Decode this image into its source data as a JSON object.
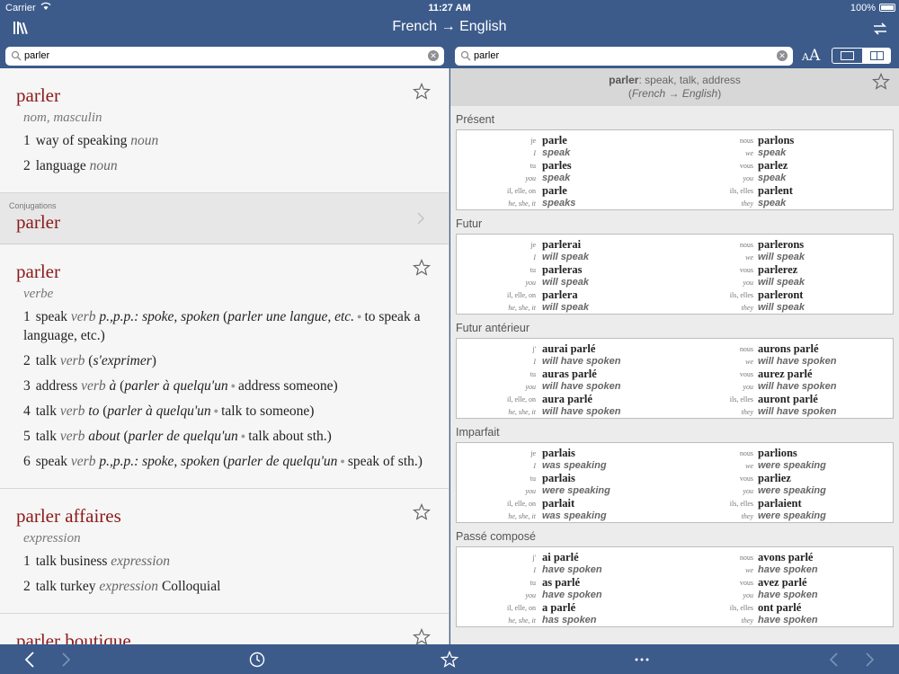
{
  "status": {
    "carrier": "Carrier",
    "time": "11:27 AM",
    "battery": "100%"
  },
  "nav": {
    "title": "French → English"
  },
  "search": {
    "left_value": "parler",
    "right_value": "parler"
  },
  "left": {
    "entry1": {
      "headword": "parler",
      "pos": "nom, masculin",
      "senses": [
        {
          "num": "1",
          "text": "way of speaking",
          "pos": "noun"
        },
        {
          "num": "2",
          "text": "language",
          "pos": "noun"
        }
      ]
    },
    "conjugations": {
      "label": "Conjugations",
      "headword": "parler"
    },
    "entry2": {
      "headword": "parler",
      "pos": "verbe",
      "senses": [
        {
          "num": "1",
          "text": "speak",
          "pos": "verb",
          "note": "p.,p.p.: spoke, spoken",
          "ex_fr": "parler une langue, etc.",
          "ex_en": "to speak a language, etc."
        },
        {
          "num": "2",
          "text": "talk",
          "pos": "verb",
          "ex_fr": "s'exprimer"
        },
        {
          "num": "3",
          "text": "address",
          "pos": "verb",
          "prep": "à",
          "ex_fr": "parler à quelqu'un",
          "ex_en": "address someone"
        },
        {
          "num": "4",
          "text": "talk",
          "pos": "verb",
          "prep": "to",
          "ex_fr": "parler à quelqu'un",
          "ex_en": "talk to someone"
        },
        {
          "num": "5",
          "text": "talk",
          "pos": "verb",
          "prep": "about",
          "ex_fr": "parler de quelqu'un",
          "ex_en": "talk about sth."
        },
        {
          "num": "6",
          "text": "speak",
          "pos": "verb",
          "note": "p.,p.p.: spoke, spoken",
          "ex_fr": "parler de quelqu'un",
          "ex_en": "speak of sth."
        }
      ]
    },
    "entry3": {
      "headword": "parler affaires",
      "pos": "expression",
      "senses": [
        {
          "num": "1",
          "text": "talk business",
          "pos": "expression"
        },
        {
          "num": "2",
          "text": "talk turkey",
          "pos": "expression",
          "extra": "Colloquial"
        }
      ]
    },
    "entry4": {
      "headword": "parler boutique"
    }
  },
  "right": {
    "summary_word": "parler",
    "summary_def": ": speak, talk, address",
    "summary_lang": "French → English",
    "tenses": [
      {
        "name": "Présent",
        "l": [
          [
            "je",
            "parle",
            "I",
            "speak"
          ],
          [
            "tu",
            "parles",
            "you",
            "speak"
          ],
          [
            "il, elle, on",
            "parle",
            "he, she, it",
            "speaks"
          ]
        ],
        "r": [
          [
            "nous",
            "parlons",
            "we",
            "speak"
          ],
          [
            "vous",
            "parlez",
            "you",
            "speak"
          ],
          [
            "ils, elles",
            "parlent",
            "they",
            "speak"
          ]
        ]
      },
      {
        "name": "Futur",
        "l": [
          [
            "je",
            "parlerai",
            "I",
            "will speak"
          ],
          [
            "tu",
            "parleras",
            "you",
            "will speak"
          ],
          [
            "il, elle, on",
            "parlera",
            "he, she, it",
            "will speak"
          ]
        ],
        "r": [
          [
            "nous",
            "parlerons",
            "we",
            "will speak"
          ],
          [
            "vous",
            "parlerez",
            "you",
            "will speak"
          ],
          [
            "ils, elles",
            "parleront",
            "they",
            "will speak"
          ]
        ]
      },
      {
        "name": "Futur antérieur",
        "l": [
          [
            "j'",
            "aurai parlé",
            "I",
            "will have spoken"
          ],
          [
            "tu",
            "auras parlé",
            "you",
            "will have spoken"
          ],
          [
            "il, elle, on",
            "aura parlé",
            "he, she, it",
            "will have spoken"
          ]
        ],
        "r": [
          [
            "nous",
            "aurons parlé",
            "we",
            "will have spoken"
          ],
          [
            "vous",
            "aurez parlé",
            "you",
            "will have spoken"
          ],
          [
            "ils, elles",
            "auront parlé",
            "they",
            "will have spoken"
          ]
        ]
      },
      {
        "name": "Imparfait",
        "l": [
          [
            "je",
            "parlais",
            "I",
            "was speaking"
          ],
          [
            "tu",
            "parlais",
            "you",
            "were speaking"
          ],
          [
            "il, elle, on",
            "parlait",
            "he, she, it",
            "was speaking"
          ]
        ],
        "r": [
          [
            "nous",
            "parlions",
            "we",
            "were speaking"
          ],
          [
            "vous",
            "parliez",
            "you",
            "were speaking"
          ],
          [
            "ils, elles",
            "parlaient",
            "they",
            "were speaking"
          ]
        ]
      },
      {
        "name": "Passé composé",
        "l": [
          [
            "j'",
            "ai parlé",
            "I",
            "have spoken"
          ],
          [
            "tu",
            "as parlé",
            "you",
            "have spoken"
          ],
          [
            "il, elle, on",
            "a parlé",
            "he, she, it",
            "has spoken"
          ]
        ],
        "r": [
          [
            "nous",
            "avons parlé",
            "we",
            "have spoken"
          ],
          [
            "vous",
            "avez parlé",
            "you",
            "have spoken"
          ],
          [
            "ils, elles",
            "ont parlé",
            "they",
            "have spoken"
          ]
        ]
      }
    ]
  }
}
